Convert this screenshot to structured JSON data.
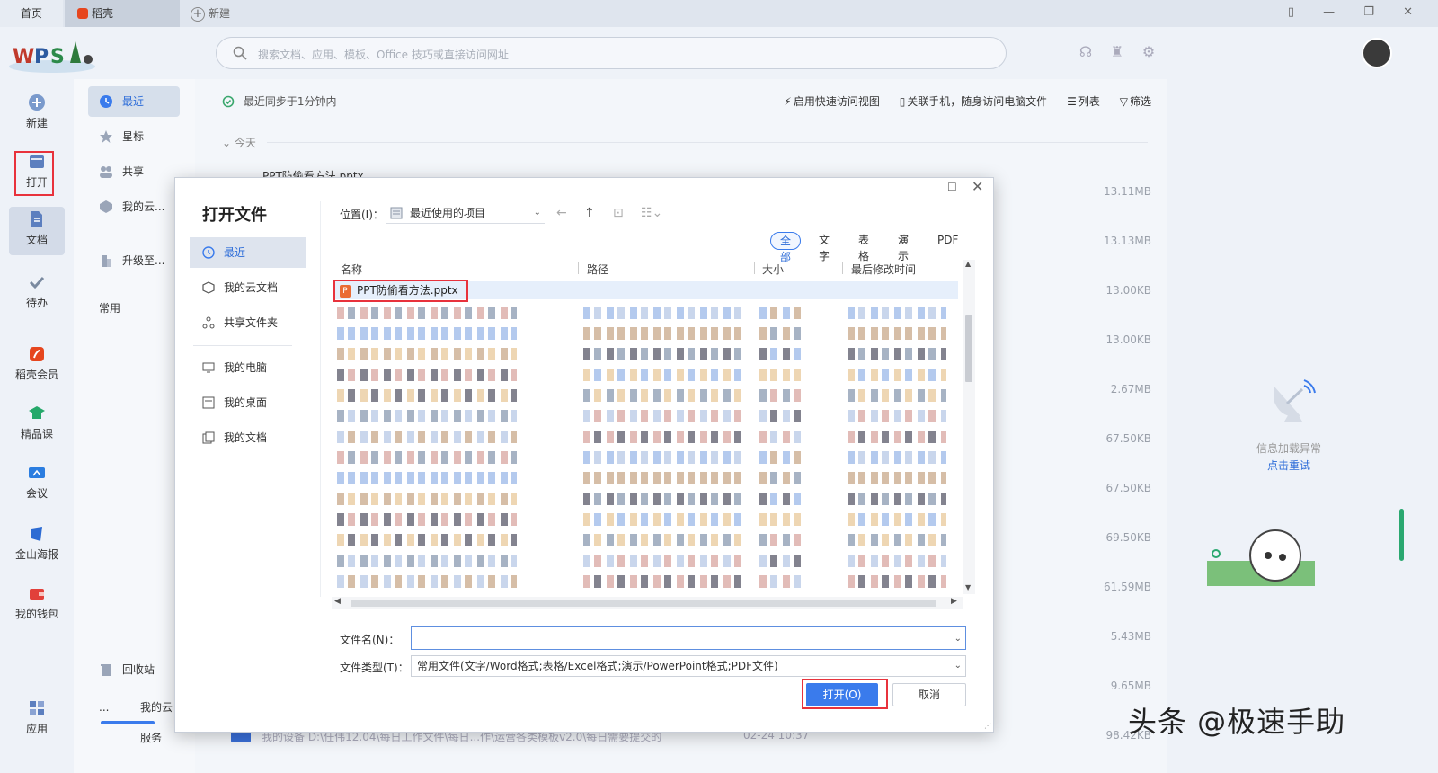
{
  "tabs": {
    "home": "首页",
    "daoke": "稻壳",
    "new": "新建"
  },
  "search": {
    "placeholder": "搜索文档、应用、模板、Office 技巧或直接访问网址"
  },
  "leftnav": {
    "new": "新建",
    "open": "打开",
    "docs": "文档",
    "todo": "待办",
    "member": "稻壳会员",
    "course": "精品课",
    "meeting": "会议",
    "poster": "金山海报",
    "wallet": "我的钱包",
    "apps": "应用"
  },
  "panel2": {
    "recent": "最近",
    "star": "星标",
    "share": "共享",
    "mycloud": "我的云...",
    "upgrade": "升级至...",
    "common": "常用",
    "recycle": "回收站",
    "cloudsvc": "我的云服务"
  },
  "main": {
    "sync": "最近同步于1分钟内",
    "quick_view": "启用快速访问视图",
    "phone": "关联手机，随身访问电脑文件",
    "list": "列表",
    "filter": "筛选",
    "today": "今天",
    "first_file_top": "PPT防偷看方法.pptx",
    "sizes": [
      "13.11MB",
      "13.13MB",
      "13.00KB",
      "13.00KB",
      "2.67MB",
      "67.50KB",
      "67.50KB",
      "69.50KB",
      "61.59MB",
      "5.43MB",
      "9.65MB",
      "98.42KB"
    ],
    "bottom_row": "我的设备 D:\\任伟12.04\\每日工作文件\\每日...作\\运营各类模板v2.0\\每日需要提交的",
    "bottom_time": "02-24 10:37"
  },
  "right": {
    "info_error": "信息加载异常",
    "retry": "点击重试",
    "watermark": "头条 @极速手助"
  },
  "dialog": {
    "title": "打开文件",
    "side": {
      "recent": "最近",
      "cloud_docs": "我的云文档",
      "shared": "共享文件夹",
      "my_pc": "我的电脑",
      "desktop": "我的桌面",
      "my_docs": "我的文档"
    },
    "location_label": "位置(I)：",
    "location_value": "最近使用的项目",
    "filter_tabs": [
      "全部",
      "文字",
      "表格",
      "演示",
      "PDF"
    ],
    "columns": {
      "name": "名称",
      "path": "路径",
      "size": "大小",
      "modified": "最后修改时间"
    },
    "first_file": "PPT防偷看方法.pptx",
    "filename_label": "文件名(N)：",
    "filename_value": "",
    "filetype_label": "文件类型(T)：",
    "filetype_value": "常用文件(文字/Word格式;表格/Excel格式;演示/PowerPoint格式;PDF文件)",
    "open_btn": "打开(O)",
    "cancel_btn": "取消"
  },
  "colors": {
    "accent": "#3a7bec",
    "highlight": "#e8323c"
  }
}
